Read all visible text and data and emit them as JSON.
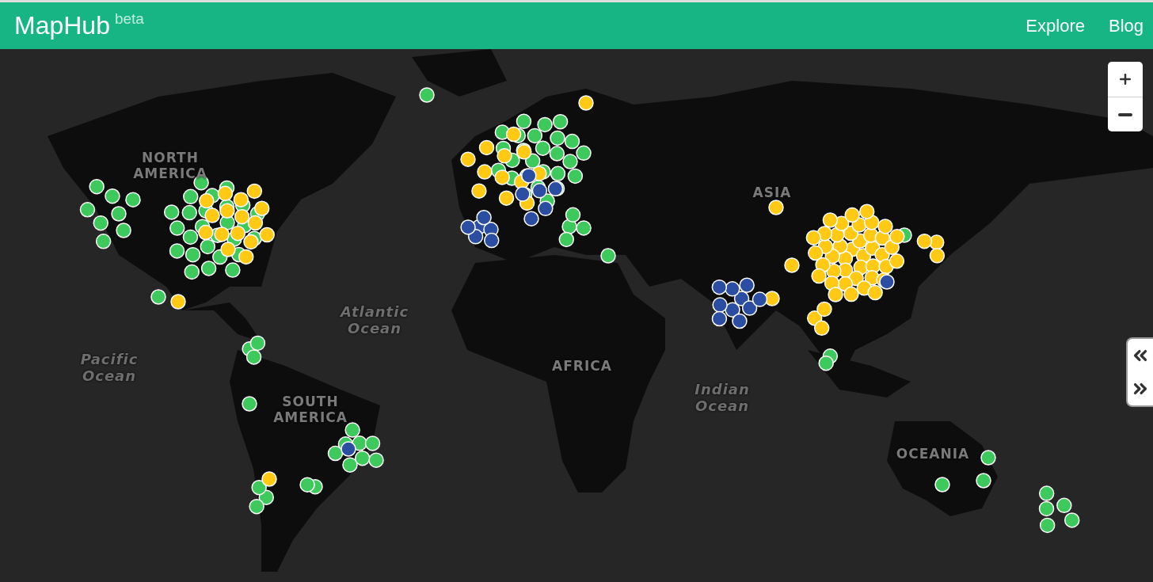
{
  "header": {
    "brand": "MapHub",
    "badge": "beta",
    "nav": [
      {
        "label": "Explore"
      },
      {
        "label": "Blog"
      }
    ]
  },
  "map": {
    "labels": [
      {
        "text": "NORTH AMERICA",
        "kind": "region"
      },
      {
        "text": "Pacific Ocean",
        "kind": "ocean"
      },
      {
        "text": "Atlantic Ocean",
        "kind": "ocean"
      },
      {
        "text": "SOUTH AMERICA",
        "kind": "region"
      },
      {
        "text": "AFRICA",
        "kind": "region"
      },
      {
        "text": "ASIA",
        "kind": "region"
      },
      {
        "text": "Indian Ocean",
        "kind": "ocean"
      },
      {
        "text": "OCEANIA",
        "kind": "region"
      }
    ],
    "marker_groups": [
      {
        "color": "#3ec95c"
      },
      {
        "color": "#ffc914"
      },
      {
        "color": "#2b4ea3"
      }
    ]
  }
}
